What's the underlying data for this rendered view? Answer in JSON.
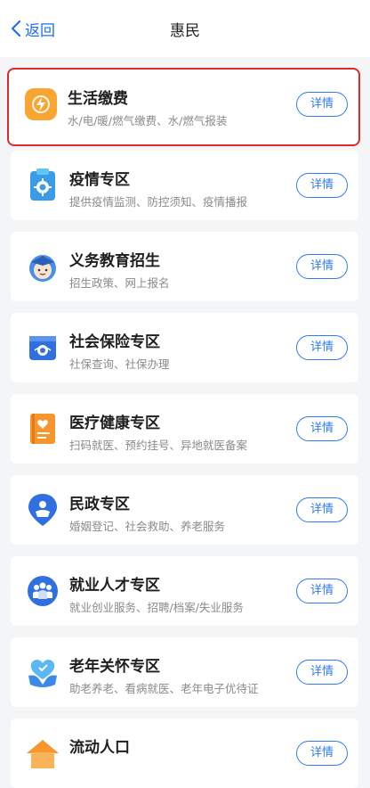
{
  "nav": {
    "back_label": "返回",
    "title": "惠民"
  },
  "items": [
    {
      "title": "生活缴费",
      "subtitle": "水/电/暖/燃气缴费、水/燃气报装",
      "button": "详情"
    },
    {
      "title": "疫情专区",
      "subtitle": "提供疫情监测、防控须知、疫情播报",
      "button": "详情"
    },
    {
      "title": "义务教育招生",
      "subtitle": "招生政策、网上报名",
      "button": "详情"
    },
    {
      "title": "社会保险专区",
      "subtitle": "社保查询、社保办理",
      "button": "详情"
    },
    {
      "title": "医疗健康专区",
      "subtitle": "扫码就医、预约挂号、异地就医备案",
      "button": "详情"
    },
    {
      "title": "民政专区",
      "subtitle": "婚姻登记、社会救助、养老服务",
      "button": "详情"
    },
    {
      "title": "就业人才专区",
      "subtitle": "就业创业服务、招聘/档案/失业服务",
      "button": "详情"
    },
    {
      "title": "老年关怀专区",
      "subtitle": "助老养老、看病就医、老年电子优待证",
      "button": "详情"
    },
    {
      "title": "流动人口",
      "subtitle": "",
      "button": "详情"
    }
  ],
  "colors": {
    "accent": "#2f7bf6",
    "highlight": "#e0292e"
  }
}
